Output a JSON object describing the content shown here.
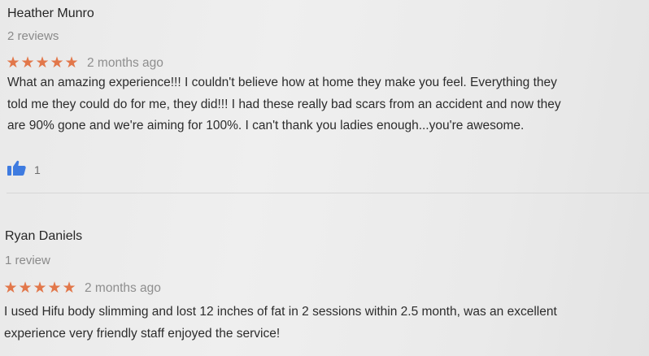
{
  "reviews": [
    {
      "author": "Heather Munro",
      "review_count": "2 reviews",
      "rating": 5,
      "time": "2 months ago",
      "text_lines": [
        "What an amazing experience!!! I couldn't believe how at home they make you feel. Everything they",
        "told me they could do for me, they did!!! I had these really bad scars from an accident and now they",
        "are 90% gone and we're aiming for 100%. I can't thank you ladies enough...you're awesome."
      ],
      "likes": "1"
    },
    {
      "author": "Ryan Daniels",
      "review_count": "1 review",
      "rating": 5,
      "time": "2 months ago",
      "text_lines": [
        "I used Hifu body slimming and lost 12 inches of fat in 2 sessions within 2.5 month, was an excellent",
        "experience very friendly staff enjoyed the service!"
      ]
    }
  ],
  "icons": {
    "star": "star-icon",
    "like": "thumbs-up-icon"
  },
  "colors": {
    "star": "#e2774a",
    "like_icon": "#3e7be0",
    "meta_text": "#8a8a8a"
  }
}
